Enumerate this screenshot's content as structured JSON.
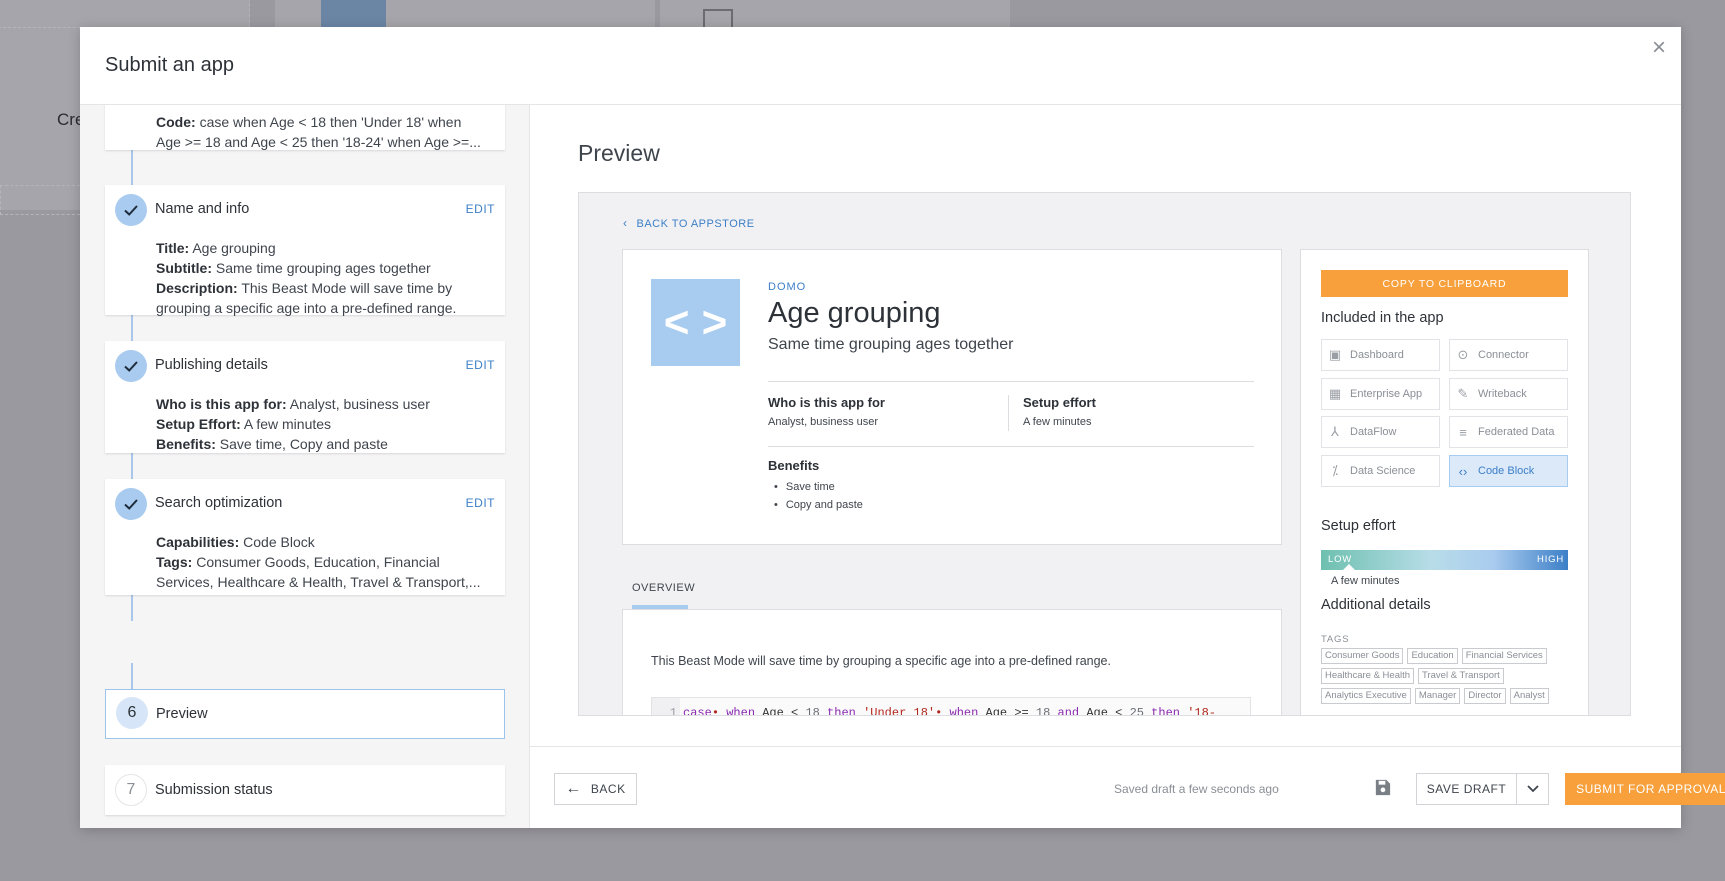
{
  "background": {
    "partial_text": "Cre"
  },
  "modal": {
    "title": "Submit an app",
    "close_label": "×"
  },
  "steps": {
    "code": {
      "label": "Code:",
      "value": "case when Age < 18 then 'Under 18' when Age >= 18 and Age < 25 then '18-24' when Age >=..."
    },
    "name_info": {
      "title": "Name and info",
      "edit": "EDIT",
      "fields": [
        {
          "label": "Title:",
          "value": "Age grouping"
        },
        {
          "label": "Subtitle:",
          "value": "Same time grouping ages together"
        },
        {
          "label": "Description:",
          "value": "This Beast Mode will save time by grouping a specific age into a pre-defined range."
        }
      ]
    },
    "publishing": {
      "title": "Publishing details",
      "edit": "EDIT",
      "fields": [
        {
          "label": "Who is this app for:",
          "value": "Analyst, business user"
        },
        {
          "label": "Setup Effort:",
          "value": "A few minutes"
        },
        {
          "label": "Benefits:",
          "value": "Save time, Copy and paste"
        }
      ]
    },
    "search": {
      "title": "Search optimization",
      "edit": "EDIT",
      "fields": [
        {
          "label": "Capabilities:",
          "value": "Code Block"
        },
        {
          "label": "Tags:",
          "value": "Consumer Goods, Education, Financial Services, Healthcare & Health, Travel & Transport,..."
        }
      ]
    },
    "preview": {
      "number": "6",
      "title": "Preview"
    },
    "submission": {
      "number": "7",
      "title": "Submission status"
    }
  },
  "preview": {
    "heading": "Preview",
    "back_link": "BACK TO APPSTORE",
    "vendor": "DOMO",
    "app_title": "Age grouping",
    "app_subtitle": "Same time grouping ages together",
    "logo_glyph": "< >",
    "who_label": "Who is this app for",
    "who_value": "Analyst, business user",
    "effort_label": "Setup effort",
    "effort_value": "A few minutes",
    "benefits_label": "Benefits",
    "benefits": [
      "Save time",
      "Copy and paste"
    ],
    "tab_overview": "OVERVIEW",
    "description": "This Beast Mode will save time by grouping a specific age into a pre-defined range.",
    "code_line_number": "1",
    "code_tokens": {
      "t1": "case",
      "t2": "• ",
      "t3": "when",
      "t4": " Age < ",
      "t5": "18",
      "t6": " then ",
      "t7": "'Under 18'",
      "t8": "• ",
      "t9": "when",
      "t10": " Age >= ",
      "t11": "18",
      "t12": " and",
      "t13": " Age < ",
      "t14": "25",
      "t15": " then ",
      "t16": "'18-"
    },
    "side": {
      "copy_button": "COPY TO CLIPBOARD",
      "included_heading": "Included in the app",
      "included": [
        {
          "label": "Dashboard",
          "icon": "dashboard-icon",
          "active": false
        },
        {
          "label": "Connector",
          "icon": "connector-icon",
          "active": false
        },
        {
          "label": "Enterprise App",
          "icon": "enterprise-app-icon",
          "active": false
        },
        {
          "label": "Writeback",
          "icon": "writeback-icon",
          "active": false
        },
        {
          "label": "DataFlow",
          "icon": "dataflow-icon",
          "active": false
        },
        {
          "label": "Federated Data",
          "icon": "federated-data-icon",
          "active": false
        },
        {
          "label": "Data Science",
          "icon": "data-science-icon",
          "active": false
        },
        {
          "label": "Code Block",
          "icon": "code-block-icon",
          "active": true
        }
      ],
      "effort_heading": "Setup effort",
      "effort_low": "LOW",
      "effort_high": "HIGH",
      "effort_value": "A few minutes",
      "additional_heading": "Additional details",
      "tags_label": "TAGS",
      "tags": [
        "Consumer Goods",
        "Education",
        "Financial Services",
        "Healthcare & Health",
        "Travel & Transport",
        "Analytics Executive",
        "Manager",
        "Director",
        "Analyst"
      ]
    }
  },
  "footer": {
    "back": "BACK",
    "saved_text": "Saved draft a few seconds ago",
    "save_draft": "SAVE DRAFT",
    "submit": "SUBMIT FOR APPROVAL"
  },
  "colors": {
    "accent_orange": "#f7a03c",
    "accent_blue": "#3c7fc7",
    "step_circle": "#a9cbef"
  }
}
